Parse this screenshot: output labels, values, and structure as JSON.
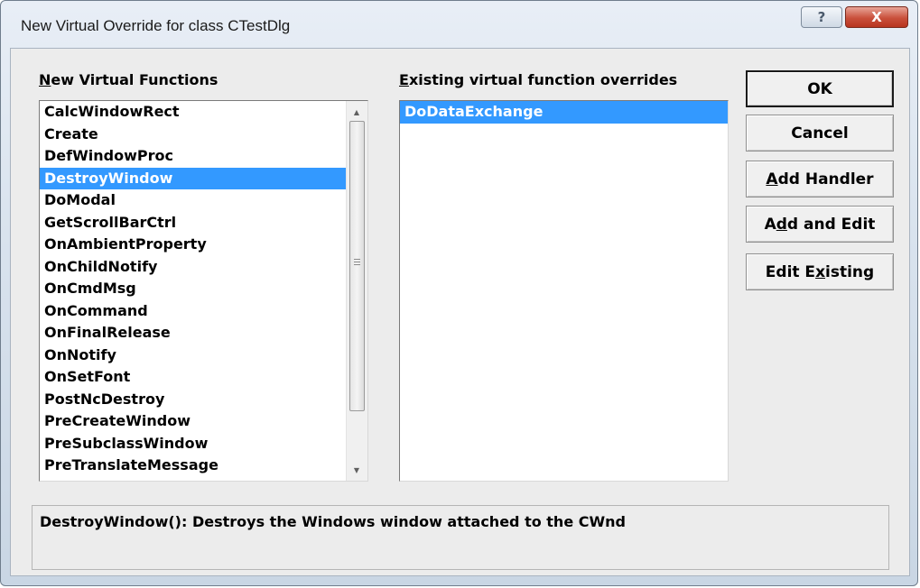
{
  "window": {
    "title": "New Virtual Override for class CTestDlg",
    "help_glyph": "?",
    "close_glyph": "X"
  },
  "left": {
    "label_accel": "N",
    "label_rest": "ew Virtual Functions",
    "items": [
      "CalcWindowRect",
      "Create",
      "DefWindowProc",
      "DestroyWindow",
      "DoModal",
      "GetScrollBarCtrl",
      "OnAmbientProperty",
      "OnChildNotify",
      "OnCmdMsg",
      "OnCommand",
      "OnFinalRelease",
      "OnNotify",
      "OnSetFont",
      "PostNcDestroy",
      "PreCreateWindow",
      "PreSubclassWindow",
      "PreTranslateMessage"
    ],
    "selected_index": 3
  },
  "right": {
    "label_accel": "E",
    "label_rest": "xisting virtual function overrides",
    "items": [
      "DoDataExchange"
    ],
    "selected_index": 0
  },
  "buttons": {
    "ok": "OK",
    "cancel": "Cancel",
    "add_handler_accel": "A",
    "add_handler_rest": "dd Handler",
    "add_edit_pre": "A",
    "add_edit_accel": "d",
    "add_edit_rest": "d and Edit",
    "edit_existing_pre": "Edit E",
    "edit_existing_accel": "x",
    "edit_existing_rest": "isting"
  },
  "description": "DestroyWindow(): Destroys the Windows window attached to the CWnd",
  "colors": {
    "selection": "#3399ff",
    "close_button": "#c9503b"
  },
  "icons": {
    "help": "question-mark-icon",
    "close": "close-icon",
    "scroll_up": "triangle-up-icon",
    "scroll_down": "triangle-down-icon"
  }
}
